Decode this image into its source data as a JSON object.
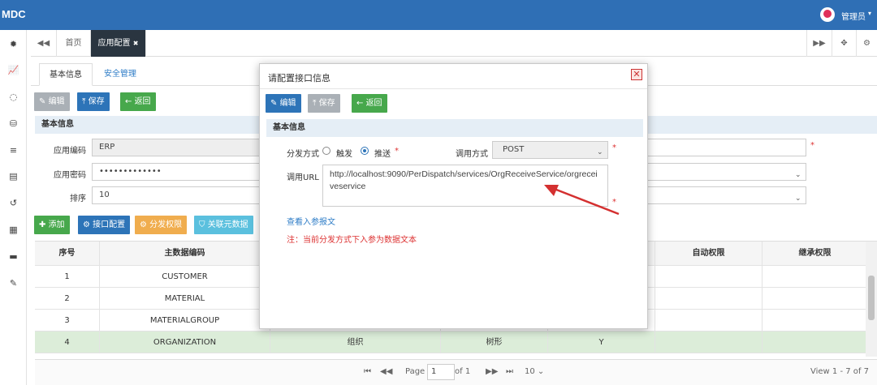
{
  "topbar": {
    "logo": "MDC",
    "user": "管理员",
    "caret": "▾"
  },
  "sidebar": {
    "icons": [
      "dashboard-icon",
      "chart-icon",
      "spinner-icon",
      "database-icon",
      "list-icon",
      "card-icon",
      "history-icon",
      "film-icon",
      "archive-icon",
      "wrench-icon"
    ]
  },
  "tabs": {
    "prev": "◀◀",
    "home": "首页",
    "current": "应用配置",
    "close": "✖",
    "next": "▶▶",
    "fullscreen": "✥",
    "settings": "⚙"
  },
  "subtabs": {
    "basic": "基本信息",
    "security": "安全管理"
  },
  "toolbar": {
    "edit": "编辑",
    "save": "保存",
    "back": "返回"
  },
  "section": {
    "basic": "基本信息"
  },
  "form": {
    "app_code_label": "应用编码",
    "app_code": "ERP",
    "app_secret_label": "应用密码",
    "app_secret": "•••••••••••••",
    "order_label": "排序",
    "order": "10"
  },
  "grid_toolbar": {
    "add": "添加",
    "interface": "接口配置",
    "dispatch": "分发权限",
    "relate": "关联元数据"
  },
  "grid": {
    "headers": [
      "序号",
      "主数据编码",
      "",
      "",
      "",
      "自动权限",
      "继承权限"
    ],
    "rows": [
      [
        "1",
        "CUSTOMER",
        "",
        "",
        "",
        "",
        ""
      ],
      [
        "2",
        "MATERIAL",
        "",
        "",
        "",
        "",
        ""
      ],
      [
        "3",
        "MATERIALGROUP",
        "",
        "",
        "",
        "",
        ""
      ],
      [
        "4",
        "ORGANIZATION",
        "组织",
        "树形",
        "Y",
        "",
        ""
      ]
    ]
  },
  "pager": {
    "page_label": "Page",
    "page": "1",
    "of": "of 1",
    "size": "10",
    "summary": "View 1 - 7 of 7"
  },
  "modal": {
    "title": "请配置接口信息",
    "close": "✕",
    "toolbar": {
      "edit": "编辑",
      "save": "保存",
      "back": "返回"
    },
    "section": "基本信息",
    "dispatch_label": "分发方式",
    "opt_trigger": "触发",
    "opt_push": "推送",
    "method_label": "调用方式",
    "method": "POST",
    "url_label": "调用URL",
    "url": "http://localhost:9090/PerDispatch/services/OrgReceiveService/orgreceiveservice",
    "link": "查看入参报文",
    "note": "注：当前分发方式下入参为数据文本",
    "required": "*"
  },
  "colors": {
    "topbar": "#2f6fb5",
    "blue": "#2d74b8",
    "green": "#47a84c",
    "orange": "#f0ad4e",
    "cyan": "#5bc0de",
    "red": "#d33",
    "arrow": "#d43030"
  }
}
